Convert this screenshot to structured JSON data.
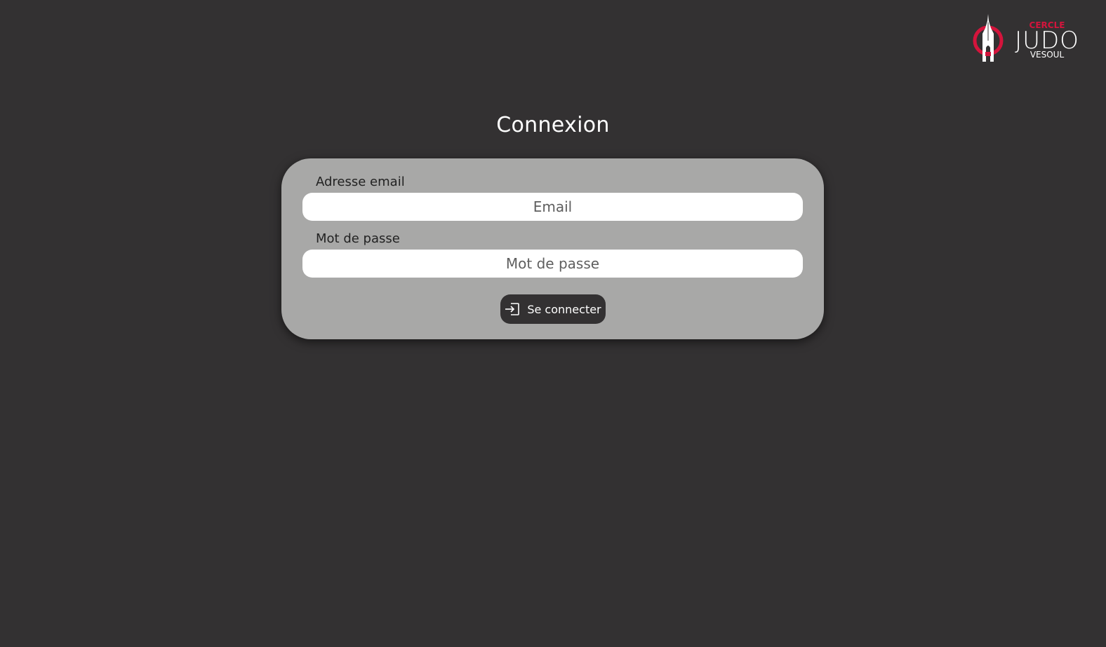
{
  "logo": {
    "top_text": "CERCLE",
    "main_text": "JUDO",
    "bottom_text": "VESOUL",
    "accent_color": "#d4143c"
  },
  "page": {
    "title": "Connexion"
  },
  "form": {
    "email_label": "Adresse email",
    "email_placeholder": "Email",
    "password_label": "Mot de passe",
    "password_placeholder": "Mot de passe",
    "submit_label": "Se connecter",
    "submit_icon": "login-icon"
  },
  "colors": {
    "background": "#333132",
    "card": "#a8a8a7",
    "button": "#333132"
  }
}
